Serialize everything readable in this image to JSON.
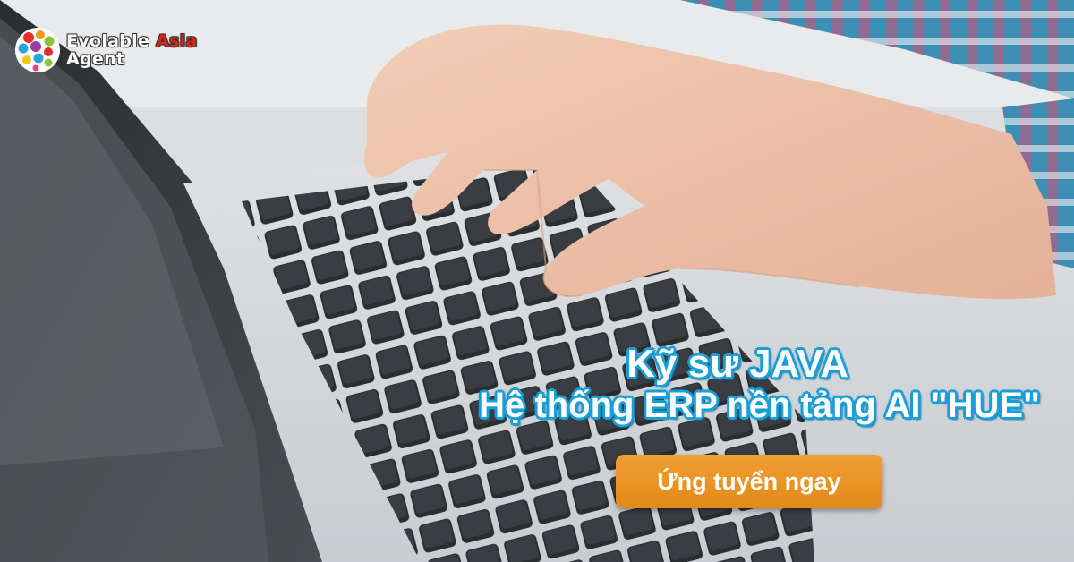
{
  "brand": {
    "name_part1": "Evolable ",
    "name_part2": "Asia",
    "name_line2": "Agent"
  },
  "headline": {
    "line1": "Kỹ sư JAVA",
    "line2": "Hệ thống ERP nền tảng AI \"HUE\""
  },
  "cta": {
    "label": "Ứng tuyển ngay"
  },
  "colors": {
    "headline_outline": "#169fd8",
    "cta_background": "#e8921f",
    "brand_accent": "#d9241b"
  }
}
